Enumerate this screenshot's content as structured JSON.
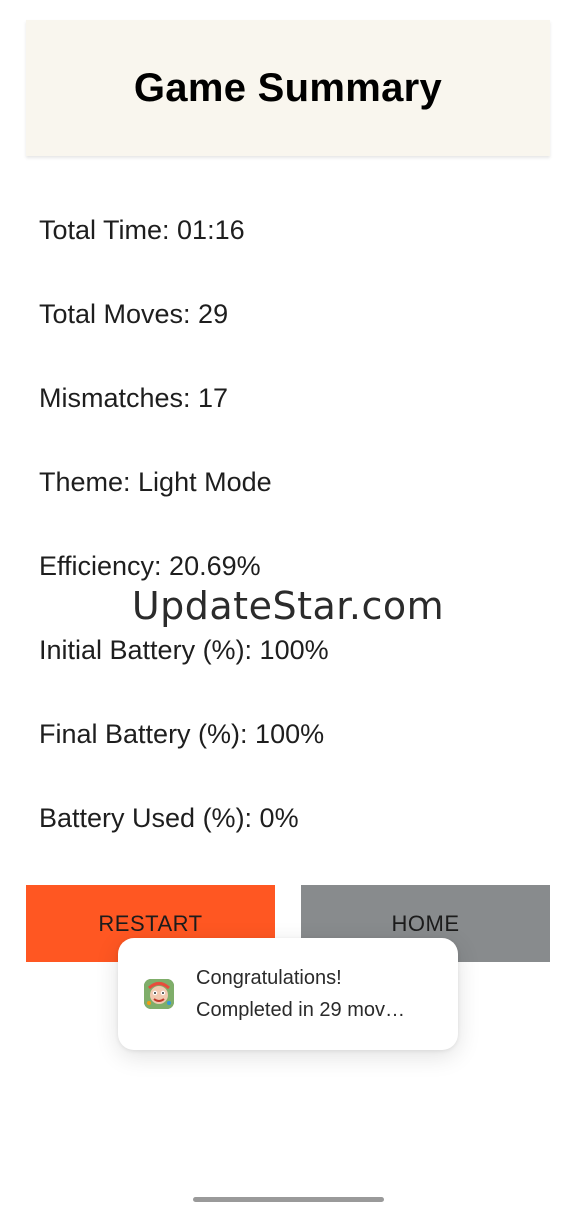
{
  "header": {
    "title": "Game Summary"
  },
  "stats": [
    {
      "text": "Total Time: 01:16"
    },
    {
      "text": "Total Moves: 29"
    },
    {
      "text": "Mismatches: 17"
    },
    {
      "text": "Theme: Light Mode"
    },
    {
      "text": "Efficiency: 20.69%"
    },
    {
      "text": "Initial Battery (%): 100%"
    },
    {
      "text": "Final Battery (%): 100%"
    },
    {
      "text": "Battery Used (%): 0%"
    }
  ],
  "watermark": "UpdateStar.com",
  "buttons": {
    "restart_label": "RESTART",
    "home_label": "HOME"
  },
  "toast": {
    "icon": "app-icon",
    "title": "Congratulations!",
    "message": "Completed in 29 mov…"
  },
  "colors": {
    "header_bg": "#f9f6ee",
    "restart_bg": "#ff5722",
    "home_bg": "#888b8d"
  }
}
